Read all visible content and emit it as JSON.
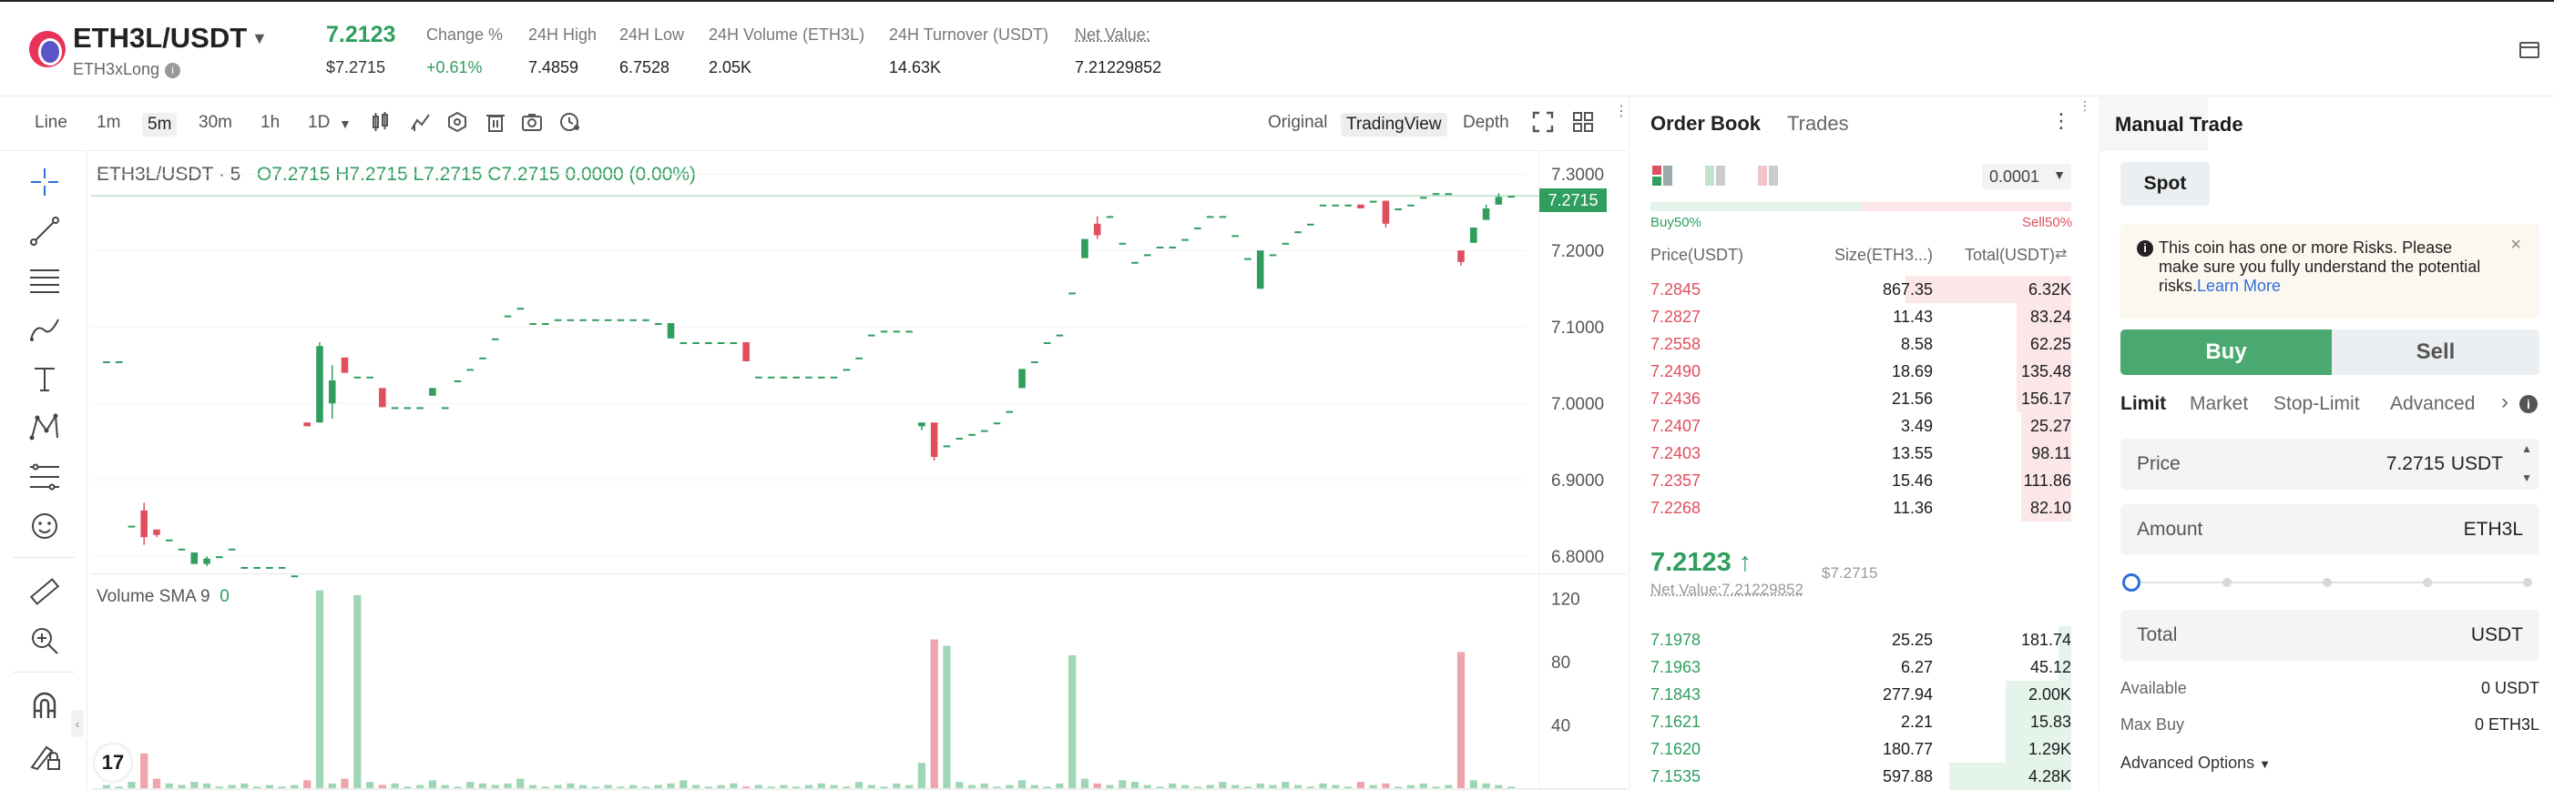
{
  "header": {
    "pair": "ETH3L/USDT",
    "subtitle": "ETH3xLong",
    "last_price": "7.2123",
    "last_price_usd": "$7.2715",
    "stats": [
      {
        "label": "Change %",
        "value": "+0.61%"
      },
      {
        "label": "24H High",
        "value": "7.4859"
      },
      {
        "label": "24H Low",
        "value": "6.7528"
      },
      {
        "label": "24H Volume (ETH3L)",
        "value": "2.05K"
      },
      {
        "label": "24H Turnover (USDT)",
        "value": "14.63K"
      },
      {
        "label": "Net Value:",
        "value": "7.21229852"
      }
    ]
  },
  "chart_toolbar": {
    "timeframes": [
      "Line",
      "1m",
      "5m",
      "30m",
      "1h",
      "1D"
    ],
    "active_timeframe": "5m",
    "views": [
      "Original",
      "TradingView",
      "Depth"
    ],
    "active_view": "TradingView"
  },
  "chart_legend": {
    "symbol": "ETH3L/USDT · 5",
    "ohlc": "O7.2715  H7.2715  L7.2715  C7.2715  0.0000 (0.00%)",
    "volume": "Volume SMA 9",
    "volume_value": "0",
    "current_price_tag": "7.2715"
  },
  "chart_data": {
    "type": "candlestick",
    "y_axis_ticks": [
      "7.3000",
      "7.2000",
      "7.1000",
      "7.0000",
      "6.9000",
      "6.8000"
    ],
    "ylim": [
      6.78,
      7.33
    ],
    "volume_axis_ticks": [
      "120",
      "80",
      "40"
    ],
    "volume_ylim": [
      0,
      130
    ],
    "candles": [
      {
        "o": 7.055,
        "h": 7.055,
        "l": 7.055,
        "c": 7.055
      },
      {
        "o": 7.055,
        "h": 7.055,
        "l": 7.055,
        "c": 7.055
      },
      {
        "o": 6.84,
        "h": 6.84,
        "l": 6.84,
        "c": 6.84
      },
      {
        "o": 6.86,
        "h": 6.87,
        "l": 6.815,
        "c": 6.825
      },
      {
        "o": 6.835,
        "h": 6.835,
        "l": 6.825,
        "c": 6.828
      },
      {
        "o": 6.822,
        "h": 6.822,
        "l": 6.822,
        "c": 6.822
      },
      {
        "o": 6.81,
        "h": 6.81,
        "l": 6.81,
        "c": 6.81
      },
      {
        "o": 6.79,
        "h": 6.805,
        "l": 6.79,
        "c": 6.805
      },
      {
        "o": 6.79,
        "h": 6.8,
        "l": 6.787,
        "c": 6.797
      },
      {
        "o": 6.8,
        "h": 6.8,
        "l": 6.8,
        "c": 6.8
      },
      {
        "o": 6.81,
        "h": 6.81,
        "l": 6.81,
        "c": 6.81
      },
      {
        "o": 6.786,
        "h": 6.786,
        "l": 6.786,
        "c": 6.786
      },
      {
        "o": 6.786,
        "h": 6.786,
        "l": 6.786,
        "c": 6.786
      },
      {
        "o": 6.786,
        "h": 6.786,
        "l": 6.786,
        "c": 6.786
      },
      {
        "o": 6.786,
        "h": 6.786,
        "l": 6.786,
        "c": 6.786
      },
      {
        "o": 6.775,
        "h": 6.775,
        "l": 6.775,
        "c": 6.775
      },
      {
        "o": 6.975,
        "h": 6.975,
        "l": 6.97,
        "c": 6.97
      },
      {
        "o": 6.975,
        "h": 7.08,
        "l": 6.975,
        "c": 7.075
      },
      {
        "o": 7.0,
        "h": 7.05,
        "l": 6.98,
        "c": 7.03
      },
      {
        "o": 7.06,
        "h": 7.06,
        "l": 7.04,
        "c": 7.04
      },
      {
        "o": 7.035,
        "h": 7.035,
        "l": 7.035,
        "c": 7.035
      },
      {
        "o": 7.035,
        "h": 7.035,
        "l": 7.035,
        "c": 7.035
      },
      {
        "o": 7.02,
        "h": 7.02,
        "l": 6.995,
        "c": 6.995
      },
      {
        "o": 6.995,
        "h": 6.995,
        "l": 6.995,
        "c": 6.995
      },
      {
        "o": 6.995,
        "h": 6.995,
        "l": 6.995,
        "c": 6.995
      },
      {
        "o": 6.995,
        "h": 6.995,
        "l": 6.995,
        "c": 6.995
      },
      {
        "o": 7.01,
        "h": 7.02,
        "l": 7.01,
        "c": 7.02
      },
      {
        "o": 6.995,
        "h": 6.995,
        "l": 6.995,
        "c": 6.995
      },
      {
        "o": 7.03,
        "h": 7.03,
        "l": 7.03,
        "c": 7.03
      },
      {
        "o": 7.045,
        "h": 7.045,
        "l": 7.045,
        "c": 7.045
      },
      {
        "o": 7.06,
        "h": 7.06,
        "l": 7.06,
        "c": 7.06
      },
      {
        "o": 7.085,
        "h": 7.085,
        "l": 7.085,
        "c": 7.085
      },
      {
        "o": 7.115,
        "h": 7.115,
        "l": 7.115,
        "c": 7.115
      },
      {
        "o": 7.125,
        "h": 7.125,
        "l": 7.125,
        "c": 7.125
      },
      {
        "o": 7.105,
        "h": 7.105,
        "l": 7.105,
        "c": 7.105
      },
      {
        "o": 7.105,
        "h": 7.105,
        "l": 7.105,
        "c": 7.105
      },
      {
        "o": 7.11,
        "h": 7.11,
        "l": 7.11,
        "c": 7.11
      },
      {
        "o": 7.11,
        "h": 7.11,
        "l": 7.11,
        "c": 7.11
      },
      {
        "o": 7.11,
        "h": 7.11,
        "l": 7.11,
        "c": 7.11
      },
      {
        "o": 7.11,
        "h": 7.11,
        "l": 7.11,
        "c": 7.11
      },
      {
        "o": 7.11,
        "h": 7.11,
        "l": 7.11,
        "c": 7.11
      },
      {
        "o": 7.11,
        "h": 7.11,
        "l": 7.11,
        "c": 7.11
      },
      {
        "o": 7.11,
        "h": 7.11,
        "l": 7.11,
        "c": 7.11
      },
      {
        "o": 7.11,
        "h": 7.11,
        "l": 7.11,
        "c": 7.11
      },
      {
        "o": 7.105,
        "h": 7.105,
        "l": 7.105,
        "c": 7.105
      },
      {
        "o": 7.085,
        "h": 7.105,
        "l": 7.085,
        "c": 7.105
      },
      {
        "o": 7.08,
        "h": 7.08,
        "l": 7.08,
        "c": 7.08
      },
      {
        "o": 7.08,
        "h": 7.08,
        "l": 7.08,
        "c": 7.08
      },
      {
        "o": 7.08,
        "h": 7.08,
        "l": 7.08,
        "c": 7.08
      },
      {
        "o": 7.08,
        "h": 7.08,
        "l": 7.08,
        "c": 7.08
      },
      {
        "o": 7.08,
        "h": 7.08,
        "l": 7.08,
        "c": 7.08
      },
      {
        "o": 7.08,
        "h": 7.08,
        "l": 7.055,
        "c": 7.055
      },
      {
        "o": 7.035,
        "h": 7.035,
        "l": 7.035,
        "c": 7.035
      },
      {
        "o": 7.035,
        "h": 7.035,
        "l": 7.035,
        "c": 7.035
      },
      {
        "o": 7.035,
        "h": 7.035,
        "l": 7.035,
        "c": 7.035
      },
      {
        "o": 7.035,
        "h": 7.035,
        "l": 7.035,
        "c": 7.035
      },
      {
        "o": 7.035,
        "h": 7.035,
        "l": 7.035,
        "c": 7.035
      },
      {
        "o": 7.035,
        "h": 7.035,
        "l": 7.035,
        "c": 7.035
      },
      {
        "o": 7.035,
        "h": 7.035,
        "l": 7.035,
        "c": 7.035
      },
      {
        "o": 7.045,
        "h": 7.045,
        "l": 7.045,
        "c": 7.045
      },
      {
        "o": 7.06,
        "h": 7.06,
        "l": 7.06,
        "c": 7.06
      },
      {
        "o": 7.09,
        "h": 7.09,
        "l": 7.09,
        "c": 7.09
      },
      {
        "o": 7.095,
        "h": 7.095,
        "l": 7.095,
        "c": 7.095
      },
      {
        "o": 7.095,
        "h": 7.095,
        "l": 7.095,
        "c": 7.095
      },
      {
        "o": 7.095,
        "h": 7.095,
        "l": 7.095,
        "c": 7.095
      },
      {
        "o": 6.97,
        "h": 6.975,
        "l": 6.965,
        "c": 6.975
      },
      {
        "o": 6.975,
        "h": 6.975,
        "l": 6.925,
        "c": 6.93
      },
      {
        "o": 6.945,
        "h": 6.945,
        "l": 6.945,
        "c": 6.945
      },
      {
        "o": 6.955,
        "h": 6.955,
        "l": 6.955,
        "c": 6.955
      },
      {
        "o": 6.96,
        "h": 6.96,
        "l": 6.96,
        "c": 6.96
      },
      {
        "o": 6.965,
        "h": 6.965,
        "l": 6.965,
        "c": 6.965
      },
      {
        "o": 6.975,
        "h": 6.975,
        "l": 6.975,
        "c": 6.975
      },
      {
        "o": 6.99,
        "h": 6.99,
        "l": 6.99,
        "c": 6.99
      },
      {
        "o": 7.02,
        "h": 7.045,
        "l": 7.02,
        "c": 7.045
      },
      {
        "o": 7.055,
        "h": 7.055,
        "l": 7.055,
        "c": 7.055
      },
      {
        "o": 7.08,
        "h": 7.08,
        "l": 7.08,
        "c": 7.08
      },
      {
        "o": 7.09,
        "h": 7.09,
        "l": 7.09,
        "c": 7.09
      },
      {
        "o": 7.145,
        "h": 7.145,
        "l": 7.145,
        "c": 7.145
      },
      {
        "o": 7.19,
        "h": 7.215,
        "l": 7.19,
        "c": 7.215
      },
      {
        "o": 7.235,
        "h": 7.245,
        "l": 7.215,
        "c": 7.22
      },
      {
        "o": 7.245,
        "h": 7.245,
        "l": 7.245,
        "c": 7.245
      },
      {
        "o": 7.21,
        "h": 7.21,
        "l": 7.21,
        "c": 7.21
      },
      {
        "o": 7.185,
        "h": 7.185,
        "l": 7.185,
        "c": 7.185
      },
      {
        "o": 7.195,
        "h": 7.195,
        "l": 7.195,
        "c": 7.195
      },
      {
        "o": 7.205,
        "h": 7.205,
        "l": 7.205,
        "c": 7.205
      },
      {
        "o": 7.205,
        "h": 7.205,
        "l": 7.205,
        "c": 7.205
      },
      {
        "o": 7.215,
        "h": 7.215,
        "l": 7.215,
        "c": 7.215
      },
      {
        "o": 7.23,
        "h": 7.23,
        "l": 7.23,
        "c": 7.23
      },
      {
        "o": 7.245,
        "h": 7.245,
        "l": 7.245,
        "c": 7.245
      },
      {
        "o": 7.245,
        "h": 7.245,
        "l": 7.245,
        "c": 7.245
      },
      {
        "o": 7.22,
        "h": 7.22,
        "l": 7.22,
        "c": 7.22
      },
      {
        "o": 7.19,
        "h": 7.19,
        "l": 7.19,
        "c": 7.19
      },
      {
        "o": 7.15,
        "h": 7.2,
        "l": 7.15,
        "c": 7.2
      },
      {
        "o": 7.195,
        "h": 7.195,
        "l": 7.195,
        "c": 7.195
      },
      {
        "o": 7.21,
        "h": 7.21,
        "l": 7.21,
        "c": 7.21
      },
      {
        "o": 7.225,
        "h": 7.225,
        "l": 7.225,
        "c": 7.225
      },
      {
        "o": 7.235,
        "h": 7.235,
        "l": 7.235,
        "c": 7.235
      },
      {
        "o": 7.26,
        "h": 7.26,
        "l": 7.26,
        "c": 7.26
      },
      {
        "o": 7.26,
        "h": 7.26,
        "l": 7.26,
        "c": 7.26
      },
      {
        "o": 7.26,
        "h": 7.26,
        "l": 7.26,
        "c": 7.26
      },
      {
        "o": 7.26,
        "h": 7.26,
        "l": 7.255,
        "c": 7.255
      },
      {
        "o": 7.265,
        "h": 7.265,
        "l": 7.265,
        "c": 7.265
      },
      {
        "o": 7.265,
        "h": 7.265,
        "l": 7.23,
        "c": 7.235
      },
      {
        "o": 7.255,
        "h": 7.255,
        "l": 7.255,
        "c": 7.255
      },
      {
        "o": 7.26,
        "h": 7.26,
        "l": 7.26,
        "c": 7.26
      },
      {
        "o": 7.27,
        "h": 7.27,
        "l": 7.27,
        "c": 7.27
      },
      {
        "o": 7.275,
        "h": 7.275,
        "l": 7.275,
        "c": 7.275
      },
      {
        "o": 7.275,
        "h": 7.275,
        "l": 7.275,
        "c": 7.275
      },
      {
        "o": 7.2,
        "h": 7.2,
        "l": 7.18,
        "c": 7.185
      },
      {
        "o": 7.21,
        "h": 7.23,
        "l": 7.21,
        "c": 7.23
      },
      {
        "o": 7.24,
        "h": 7.26,
        "l": 7.24,
        "c": 7.255
      },
      {
        "o": 7.26,
        "h": 7.275,
        "l": 7.26,
        "c": 7.27
      },
      {
        "o": 7.2715,
        "h": 7.2715,
        "l": 7.2715,
        "c": 7.2715
      }
    ],
    "volumes": [
      2,
      1,
      4,
      22,
      6,
      3,
      2,
      4,
      3,
      1,
      2,
      3,
      1,
      2,
      1,
      2,
      5,
      125,
      3,
      6,
      122,
      4,
      2,
      3,
      1,
      2,
      5,
      2,
      1,
      4,
      3,
      2,
      3,
      6,
      2,
      1,
      2,
      3,
      2,
      1,
      2,
      1,
      2,
      1,
      2,
      3,
      5,
      2,
      1,
      2,
      3,
      1,
      2,
      1,
      2,
      1,
      2,
      3,
      2,
      1,
      4,
      2,
      1,
      3,
      2,
      16,
      94,
      90,
      4,
      2,
      3,
      1,
      2,
      5,
      2,
      1,
      3,
      84,
      6,
      3,
      2,
      5,
      4,
      2,
      1,
      3,
      2,
      1,
      2,
      4,
      2,
      1,
      3,
      2,
      4,
      2,
      1,
      3,
      2,
      1,
      4,
      2,
      3,
      1,
      2,
      3,
      1,
      2,
      86,
      5,
      3,
      2,
      1
    ]
  },
  "orderbook": {
    "tabs": [
      "Order Book",
      "Trades"
    ],
    "precision": "0.0001",
    "buy_pct": "Buy50%",
    "sell_pct": "Sell50%",
    "buy_fraction": 0.5,
    "headers": [
      "Price(USDT)",
      "Size(ETH3...)",
      "Total(USDT)"
    ],
    "asks": [
      {
        "price": "7.2845",
        "size": "867.35",
        "total": "6.32K",
        "depth": 0.395
      },
      {
        "price": "7.2827",
        "size": "11.43",
        "total": "83.24",
        "depth": 0.13
      },
      {
        "price": "7.2558",
        "size": "8.58",
        "total": "62.25",
        "depth": 0.13
      },
      {
        "price": "7.2490",
        "size": "18.69",
        "total": "135.48",
        "depth": 0.13
      },
      {
        "price": "7.2436",
        "size": "21.56",
        "total": "156.17",
        "depth": 0.13
      },
      {
        "price": "7.2407",
        "size": "3.49",
        "total": "25.27",
        "depth": 0.12
      },
      {
        "price": "7.2403",
        "size": "13.55",
        "total": "98.11",
        "depth": 0.12
      },
      {
        "price": "7.2357",
        "size": "15.46",
        "total": "111.86",
        "depth": 0.12
      },
      {
        "price": "7.2268",
        "size": "11.36",
        "total": "82.10",
        "depth": 0.12
      }
    ],
    "mid_price": "7.2123",
    "mid_arrow": "↑",
    "mid_usd": "$7.2715",
    "net_value": "Net Value:7.21229852",
    "bids": [
      {
        "price": "7.1978",
        "size": "25.25",
        "total": "181.74",
        "depth": 0.03
      },
      {
        "price": "7.1963",
        "size": "6.27",
        "total": "45.12",
        "depth": 0.03
      },
      {
        "price": "7.1843",
        "size": "277.94",
        "total": "2.00K",
        "depth": 0.155
      },
      {
        "price": "7.1621",
        "size": "2.21",
        "total": "15.83",
        "depth": 0.155
      },
      {
        "price": "7.1620",
        "size": "180.77",
        "total": "1.29K",
        "depth": 0.155
      },
      {
        "price": "7.1535",
        "size": "597.88",
        "total": "4.28K",
        "depth": 0.29
      }
    ]
  },
  "trade": {
    "title": "Manual Trade",
    "mode": "Spot",
    "risk_notice": "This coin has one or more Risks. Please make sure you fully understand the potential risks.",
    "risk_link": "Learn More",
    "buy_label": "Buy",
    "sell_label": "Sell",
    "order_types": [
      "Limit",
      "Market",
      "Stop-Limit",
      "Advanced"
    ],
    "price_label": "Price",
    "price_value": "7.2715",
    "price_unit": "USDT",
    "amount_label": "Amount",
    "amount_unit": "ETH3L",
    "slider_fraction": 0,
    "total_label": "Total",
    "total_unit": "USDT",
    "available_label": "Available",
    "available_value": "0 USDT",
    "maxbuy_label": "Max Buy",
    "maxbuy_value": "0 ETH3L",
    "advanced_options": "Advanced Options"
  },
  "colors": {
    "up": "#2f9e5e",
    "down": "#e04f5f",
    "up_light": "#e4f4ea",
    "down_light": "#fbe6e8",
    "buy_button": "#4aa971"
  }
}
